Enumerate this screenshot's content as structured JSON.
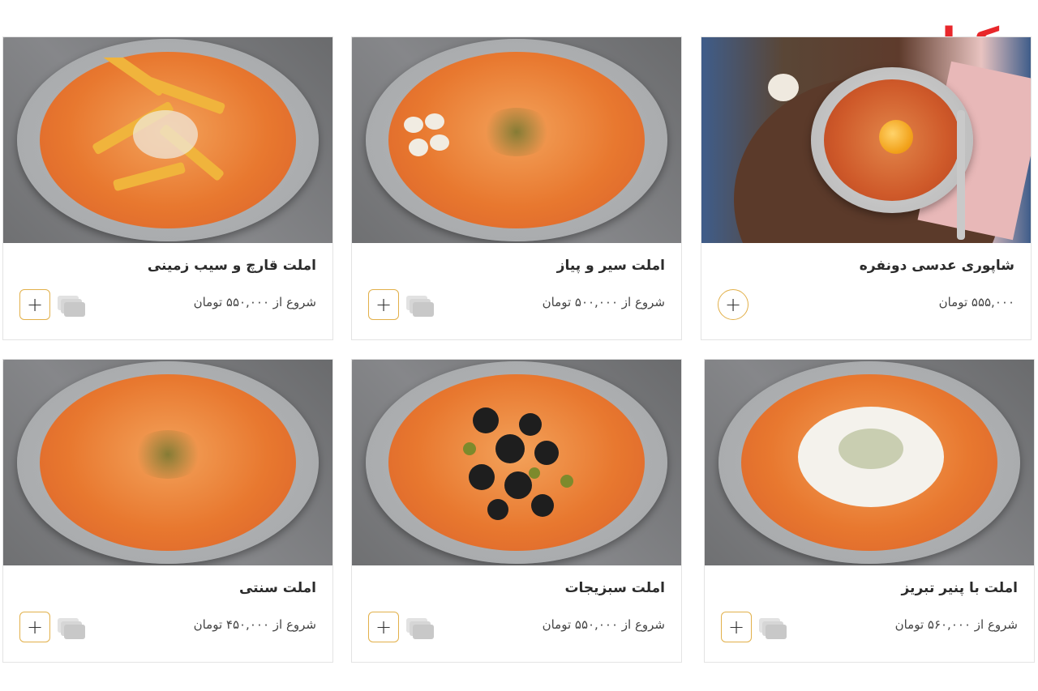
{
  "logo": {
    "text": "رکنا",
    "color": "#e8272b"
  },
  "accent_color": "#e2b04a",
  "products": [
    {
      "title": "شاپوری عدسی دونفره",
      "price": "۵۵۵,۰۰۰ تومان",
      "image_icon": "food-photo-icon"
    },
    {
      "title": "املت سیر و پیاز",
      "price": "شروع از ۵۰۰,۰۰۰ تومان",
      "image_icon": "food-photo-icon"
    },
    {
      "title": "املت قارچ و سیب زمینی",
      "price": "شروع از ۵۵۰,۰۰۰ تومان",
      "image_icon": "food-photo-icon"
    },
    {
      "title": "املت با پنیر تبریز",
      "price": "شروع از ۵۶۰,۰۰۰ تومان",
      "image_icon": "food-photo-icon"
    },
    {
      "title": "املت سبزیجات",
      "price": "شروع از ۵۵۰,۰۰۰ تومان",
      "image_icon": "food-photo-icon"
    },
    {
      "title": "املت سنتی",
      "price": "شروع از ۴۵۰,۰۰۰ تومان",
      "image_icon": "food-photo-icon"
    }
  ],
  "add_button": {
    "label": "+",
    "icon": "plus-icon"
  },
  "compare_icon": "stacked-cards-icon"
}
